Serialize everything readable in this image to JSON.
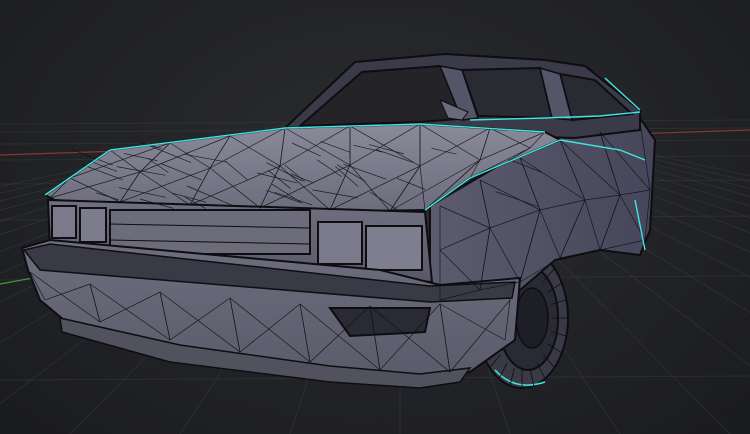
{
  "viewport": {
    "background_color": "#222326",
    "grid_color": "#3a3b40",
    "axis_x_color": "#b8413f",
    "axis_y_color": "#3f9a3a"
  },
  "model": {
    "shading": "wireframe-on-solid",
    "face_color": "#6a6a78",
    "face_color_dark": "#46465a",
    "face_color_light": "#8a8a9a",
    "wire_color": "#0d0d12",
    "selection_edge_color": "#3fe6e0"
  }
}
